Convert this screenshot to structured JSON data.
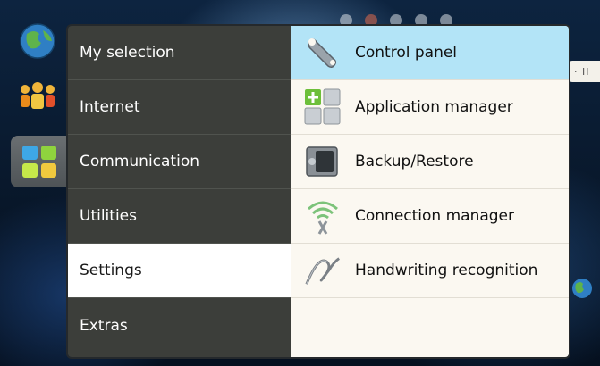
{
  "launcher": {
    "items": [
      {
        "icon": "globe-icon"
      },
      {
        "icon": "contacts-icon"
      },
      {
        "icon": "applications-grid-icon"
      }
    ]
  },
  "right_tab": {
    "label": "· II"
  },
  "menu": {
    "categories": [
      {
        "label": "My selection"
      },
      {
        "label": "Internet"
      },
      {
        "label": "Communication"
      },
      {
        "label": "Utilities"
      },
      {
        "label": "Settings"
      },
      {
        "label": "Extras"
      }
    ],
    "selected_category": "Settings",
    "apps": [
      {
        "label": "Control panel",
        "icon": "wrench-icon"
      },
      {
        "label": "Application manager",
        "icon": "app-manager-icon"
      },
      {
        "label": "Backup/Restore",
        "icon": "safe-icon"
      },
      {
        "label": "Connection manager",
        "icon": "wifi-wrench-icon"
      },
      {
        "label": "Handwriting recognition",
        "icon": "handwriting-icon"
      }
    ],
    "highlighted_app": "Control panel"
  },
  "colors": {
    "category_bg": "#3c3e3a",
    "apps_bg": "#fbf8f1",
    "highlight": "#b3e4f7"
  }
}
